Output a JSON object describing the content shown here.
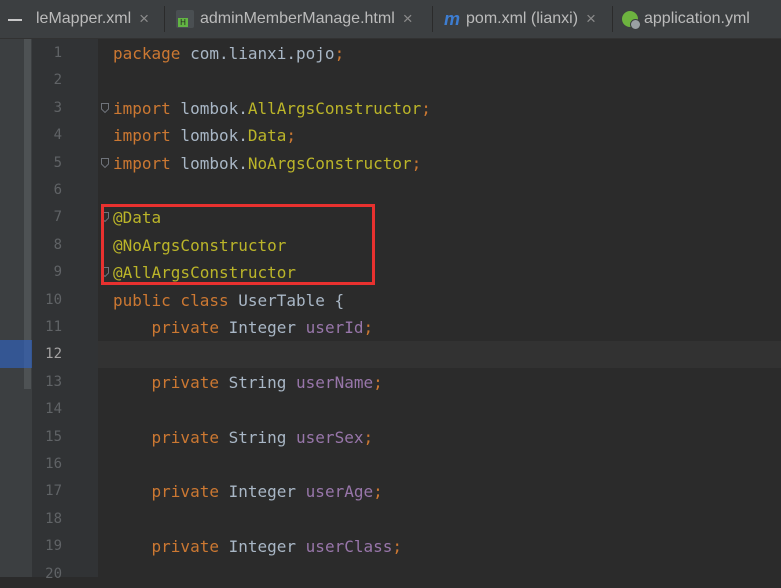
{
  "tabs": [
    {
      "label": "leMapper.xml",
      "icon": "xml-file-icon"
    },
    {
      "label": "adminMemberManage.html",
      "icon": "html-file-icon"
    },
    {
      "label": "pom.xml (lianxi)",
      "icon": "maven-icon"
    },
    {
      "label": "application.yml",
      "icon": "spring-config-icon"
    }
  ],
  "tab_close_glyph": "×",
  "maven_glyph": "m",
  "editor": {
    "current_line": 12,
    "line_numbers": [
      "1",
      "2",
      "3",
      "4",
      "5",
      "6",
      "7",
      "8",
      "9",
      "10",
      "11",
      "12",
      "13",
      "14",
      "15",
      "16",
      "17",
      "18",
      "19",
      "20"
    ],
    "lines": [
      {
        "n": 1,
        "tokens": [
          {
            "t": "package",
            "c": "kw"
          },
          {
            "t": " com.lianxi.pojo",
            "c": "plain"
          },
          {
            "t": ";",
            "c": "kw"
          }
        ]
      },
      {
        "n": 2,
        "tokens": []
      },
      {
        "n": 3,
        "tokens": [
          {
            "t": "import",
            "c": "kw"
          },
          {
            "t": " lombok.",
            "c": "plain"
          },
          {
            "t": "AllArgsConstructor",
            "c": "ann"
          },
          {
            "t": ";",
            "c": "kw"
          }
        ]
      },
      {
        "n": 4,
        "tokens": [
          {
            "t": "import",
            "c": "kw"
          },
          {
            "t": " lombok.",
            "c": "plain"
          },
          {
            "t": "Data",
            "c": "ann"
          },
          {
            "t": ";",
            "c": "kw"
          }
        ]
      },
      {
        "n": 5,
        "tokens": [
          {
            "t": "import",
            "c": "kw"
          },
          {
            "t": " lombok.",
            "c": "plain"
          },
          {
            "t": "NoArgsConstructor",
            "c": "ann"
          },
          {
            "t": ";",
            "c": "kw"
          }
        ]
      },
      {
        "n": 6,
        "tokens": []
      },
      {
        "n": 7,
        "tokens": [
          {
            "t": "@Data",
            "c": "ann"
          }
        ]
      },
      {
        "n": 8,
        "tokens": [
          {
            "t": "@NoArgsConstructor",
            "c": "ann"
          }
        ]
      },
      {
        "n": 9,
        "tokens": [
          {
            "t": "@AllArgsConstructor",
            "c": "ann"
          }
        ]
      },
      {
        "n": 10,
        "tokens": [
          {
            "t": "public class",
            "c": "kw"
          },
          {
            "t": " UserTable {",
            "c": "plain"
          }
        ]
      },
      {
        "n": 11,
        "tokens": [
          {
            "t": "    private",
            "c": "kw"
          },
          {
            "t": " Integer ",
            "c": "plain"
          },
          {
            "t": "userId",
            "c": "fld"
          },
          {
            "t": ";",
            "c": "kw"
          }
        ]
      },
      {
        "n": 12,
        "tokens": []
      },
      {
        "n": 13,
        "tokens": [
          {
            "t": "    private",
            "c": "kw"
          },
          {
            "t": " String ",
            "c": "plain"
          },
          {
            "t": "userName",
            "c": "fld"
          },
          {
            "t": ";",
            "c": "kw"
          }
        ]
      },
      {
        "n": 14,
        "tokens": []
      },
      {
        "n": 15,
        "tokens": [
          {
            "t": "    private",
            "c": "kw"
          },
          {
            "t": " String ",
            "c": "plain"
          },
          {
            "t": "userSex",
            "c": "fld"
          },
          {
            "t": ";",
            "c": "kw"
          }
        ]
      },
      {
        "n": 16,
        "tokens": []
      },
      {
        "n": 17,
        "tokens": [
          {
            "t": "    private",
            "c": "kw"
          },
          {
            "t": " Integer ",
            "c": "plain"
          },
          {
            "t": "userAge",
            "c": "fld"
          },
          {
            "t": ";",
            "c": "kw"
          }
        ]
      },
      {
        "n": 18,
        "tokens": []
      },
      {
        "n": 19,
        "tokens": [
          {
            "t": "    private",
            "c": "kw"
          },
          {
            "t": " Integer ",
            "c": "plain"
          },
          {
            "t": "userClass",
            "c": "fld"
          },
          {
            "t": ";",
            "c": "kw"
          }
        ]
      },
      {
        "n": 20,
        "tokens": []
      }
    ],
    "fold_markers_at_lines": [
      3,
      5,
      7,
      9
    ]
  },
  "colors": {
    "keyword": "#cc7832",
    "annotation": "#bbb529",
    "field": "#9876aa",
    "plain": "#a9b7c6",
    "highlight_box": "#e8312f"
  }
}
